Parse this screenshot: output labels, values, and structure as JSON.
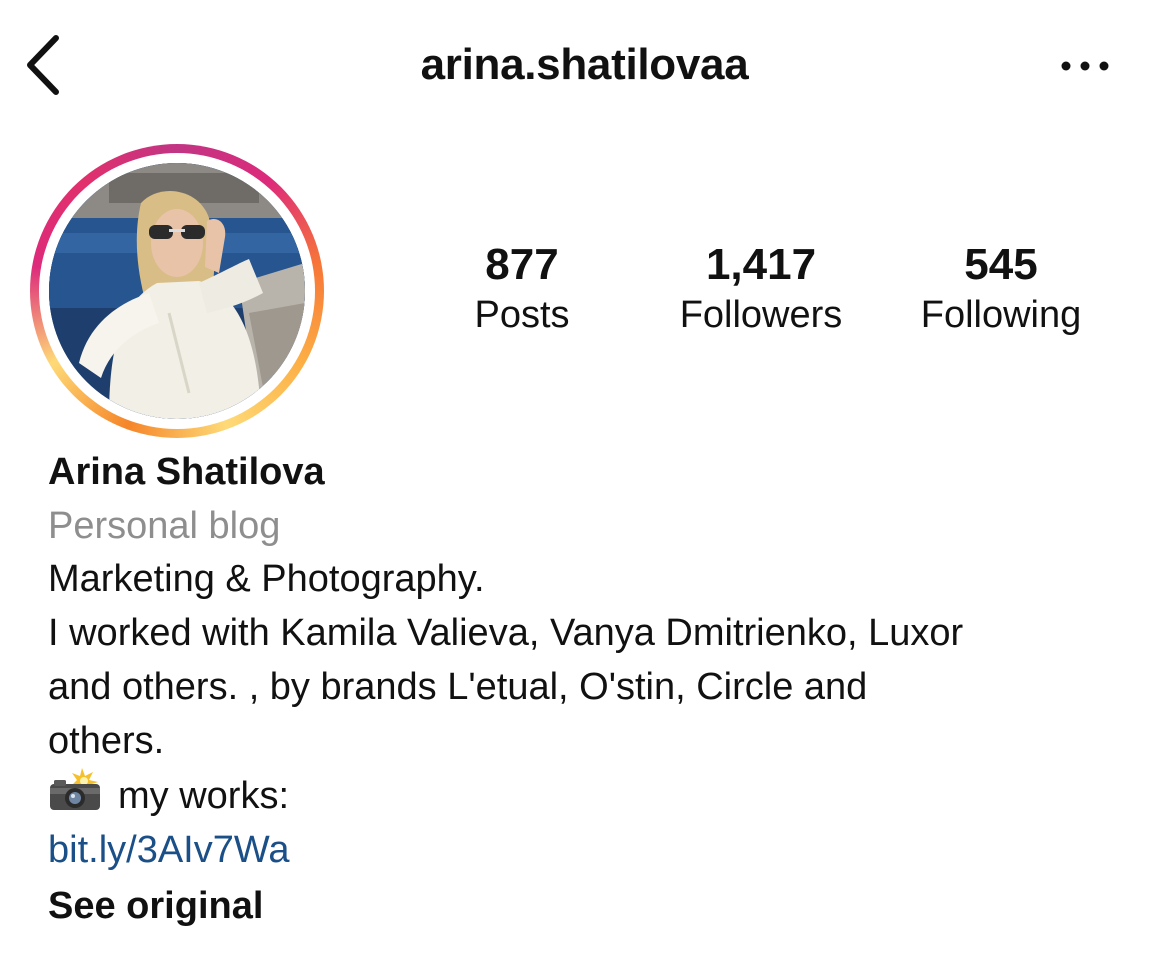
{
  "header": {
    "username": "arina.shatilovaa",
    "back_icon": "chevron-left-icon",
    "more_icon": "more-horizontal-icon"
  },
  "profile": {
    "avatar_ring_colors": [
      "#f58529",
      "#feda77",
      "#dd2a7b",
      "#c13584"
    ]
  },
  "stats": {
    "posts": {
      "count": "877",
      "label": "Posts"
    },
    "followers": {
      "count": "1,417",
      "label": "Followers"
    },
    "following": {
      "count": "545",
      "label": "Following"
    }
  },
  "bio": {
    "full_name": "Arina Shatilova",
    "category": "Personal blog",
    "text": "Marketing & Photography.\nI worked with Kamila Valieva, Vanya Dmitrienko, Luxor\nand others. , by brands L'etual, O'stin, Circle and\nothers.",
    "works_icon": "camera-flash-emoji-icon",
    "works_label": "my works:",
    "link": "bit.ly/3AIv7Wa",
    "link_color": "#1a4f87",
    "see_original": "See original"
  }
}
